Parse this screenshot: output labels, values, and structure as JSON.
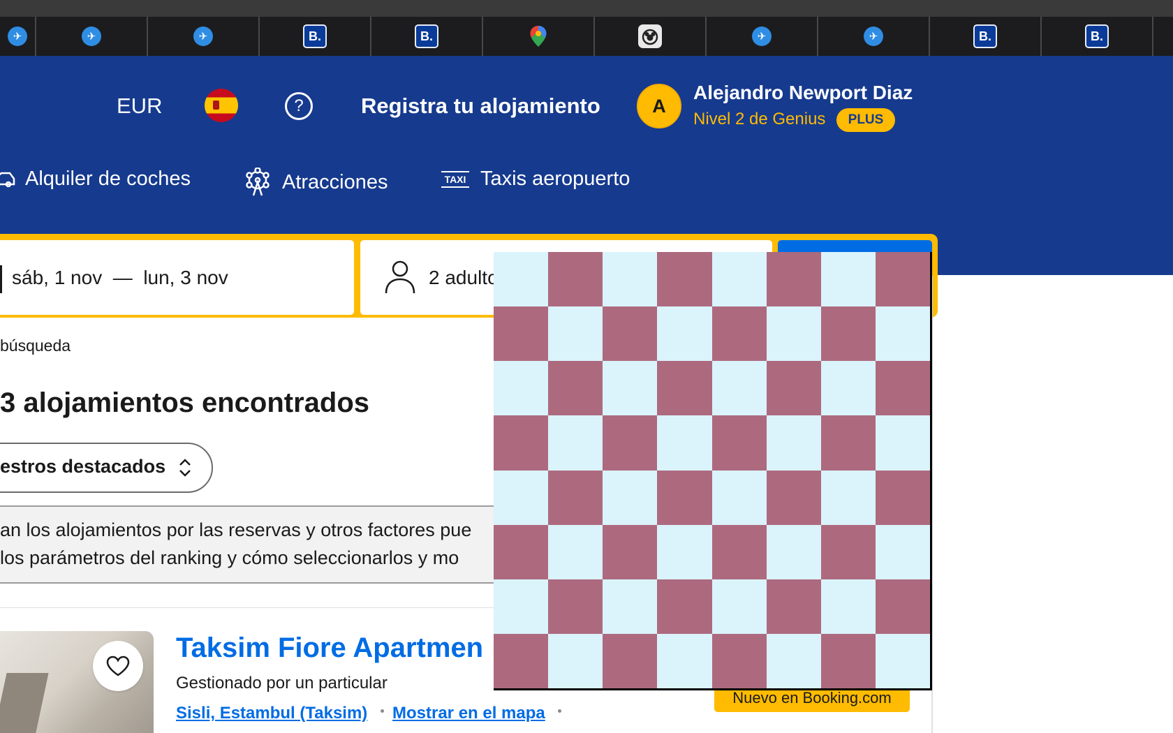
{
  "browser": {
    "tabs": [
      {
        "favicon": "plane-icon"
      },
      {
        "favicon": "plane-icon"
      },
      {
        "favicon": "plane-icon"
      },
      {
        "favicon": "booking-icon"
      },
      {
        "favicon": "booking-icon"
      },
      {
        "favicon": "google-maps-icon"
      },
      {
        "favicon": "mickey-icon"
      },
      {
        "favicon": "plane-icon"
      },
      {
        "favicon": "plane-icon"
      },
      {
        "favicon": "booking-icon"
      },
      {
        "favicon": "booking-icon"
      }
    ],
    "booking_glyph": "B."
  },
  "header": {
    "currency": "EUR",
    "help_glyph": "?",
    "register_label": "Registra tu alojamiento",
    "user": {
      "initial": "A",
      "name": "Alejandro Newport Diaz",
      "genius_level": "Nivel 2 de Genius",
      "plus_badge": "PLUS"
    },
    "nav": {
      "cars": "Alquiler de coches",
      "attractions": "Atracciones",
      "taxi": "Taxis aeropuerto",
      "taxi_icon_text": "TAXI"
    }
  },
  "search": {
    "dates": "sáb, 1 nov  —  lun, 3 nov",
    "guests": "2 adulto"
  },
  "results": {
    "breadcrumb": "búsqueda",
    "count_text": "3 alojamientos encontrados",
    "sort_label": "estros destacados",
    "notice_line1": "an los alojamientos por las reservas y otros factores pue",
    "notice_line2": "los parámetros del ranking y cómo seleccionarlos y mo"
  },
  "property": {
    "title": "Taksim Fiore Apartmen",
    "managed_by": "Gestionado por un particular",
    "location": "Sisli, Estambul (Taksim)",
    "map_link": "Mostrar en el mapa",
    "new_badge": "Nuevo en Booking.com"
  },
  "overlay": {
    "type": "checkerboard",
    "rows": 8,
    "cols": 8,
    "color_a": "#dbf3fb",
    "color_b": "#ad6a7f"
  },
  "colors": {
    "brand_blue": "#163a8e",
    "accent_yellow": "#febb02",
    "link_blue": "#006ce4"
  }
}
